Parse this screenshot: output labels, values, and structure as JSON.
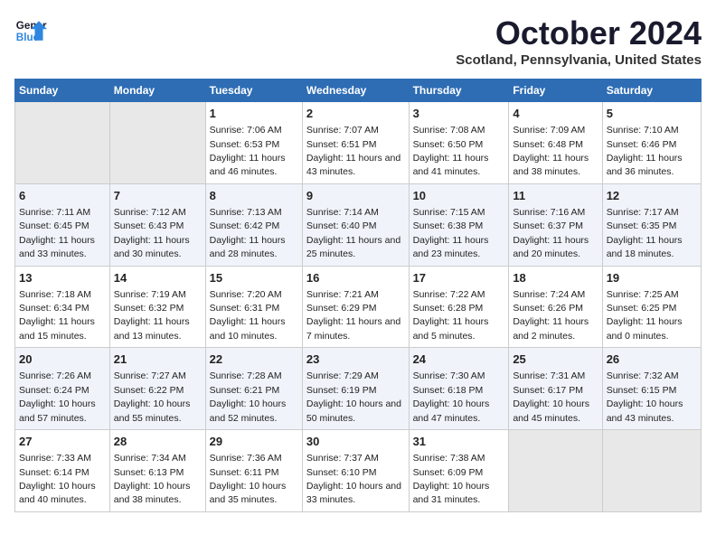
{
  "header": {
    "logo_line1": "General",
    "logo_line2": "Blue",
    "month": "October 2024",
    "location": "Scotland, Pennsylvania, United States"
  },
  "weekdays": [
    "Sunday",
    "Monday",
    "Tuesday",
    "Wednesday",
    "Thursday",
    "Friday",
    "Saturday"
  ],
  "weeks": [
    [
      {
        "day": "",
        "empty": true
      },
      {
        "day": "",
        "empty": true
      },
      {
        "day": "1",
        "sunrise": "Sunrise: 7:06 AM",
        "sunset": "Sunset: 6:53 PM",
        "daylight": "Daylight: 11 hours and 46 minutes."
      },
      {
        "day": "2",
        "sunrise": "Sunrise: 7:07 AM",
        "sunset": "Sunset: 6:51 PM",
        "daylight": "Daylight: 11 hours and 43 minutes."
      },
      {
        "day": "3",
        "sunrise": "Sunrise: 7:08 AM",
        "sunset": "Sunset: 6:50 PM",
        "daylight": "Daylight: 11 hours and 41 minutes."
      },
      {
        "day": "4",
        "sunrise": "Sunrise: 7:09 AM",
        "sunset": "Sunset: 6:48 PM",
        "daylight": "Daylight: 11 hours and 38 minutes."
      },
      {
        "day": "5",
        "sunrise": "Sunrise: 7:10 AM",
        "sunset": "Sunset: 6:46 PM",
        "daylight": "Daylight: 11 hours and 36 minutes."
      }
    ],
    [
      {
        "day": "6",
        "sunrise": "Sunrise: 7:11 AM",
        "sunset": "Sunset: 6:45 PM",
        "daylight": "Daylight: 11 hours and 33 minutes."
      },
      {
        "day": "7",
        "sunrise": "Sunrise: 7:12 AM",
        "sunset": "Sunset: 6:43 PM",
        "daylight": "Daylight: 11 hours and 30 minutes."
      },
      {
        "day": "8",
        "sunrise": "Sunrise: 7:13 AM",
        "sunset": "Sunset: 6:42 PM",
        "daylight": "Daylight: 11 hours and 28 minutes."
      },
      {
        "day": "9",
        "sunrise": "Sunrise: 7:14 AM",
        "sunset": "Sunset: 6:40 PM",
        "daylight": "Daylight: 11 hours and 25 minutes."
      },
      {
        "day": "10",
        "sunrise": "Sunrise: 7:15 AM",
        "sunset": "Sunset: 6:38 PM",
        "daylight": "Daylight: 11 hours and 23 minutes."
      },
      {
        "day": "11",
        "sunrise": "Sunrise: 7:16 AM",
        "sunset": "Sunset: 6:37 PM",
        "daylight": "Daylight: 11 hours and 20 minutes."
      },
      {
        "day": "12",
        "sunrise": "Sunrise: 7:17 AM",
        "sunset": "Sunset: 6:35 PM",
        "daylight": "Daylight: 11 hours and 18 minutes."
      }
    ],
    [
      {
        "day": "13",
        "sunrise": "Sunrise: 7:18 AM",
        "sunset": "Sunset: 6:34 PM",
        "daylight": "Daylight: 11 hours and 15 minutes."
      },
      {
        "day": "14",
        "sunrise": "Sunrise: 7:19 AM",
        "sunset": "Sunset: 6:32 PM",
        "daylight": "Daylight: 11 hours and 13 minutes."
      },
      {
        "day": "15",
        "sunrise": "Sunrise: 7:20 AM",
        "sunset": "Sunset: 6:31 PM",
        "daylight": "Daylight: 11 hours and 10 minutes."
      },
      {
        "day": "16",
        "sunrise": "Sunrise: 7:21 AM",
        "sunset": "Sunset: 6:29 PM",
        "daylight": "Daylight: 11 hours and 7 minutes."
      },
      {
        "day": "17",
        "sunrise": "Sunrise: 7:22 AM",
        "sunset": "Sunset: 6:28 PM",
        "daylight": "Daylight: 11 hours and 5 minutes."
      },
      {
        "day": "18",
        "sunrise": "Sunrise: 7:24 AM",
        "sunset": "Sunset: 6:26 PM",
        "daylight": "Daylight: 11 hours and 2 minutes."
      },
      {
        "day": "19",
        "sunrise": "Sunrise: 7:25 AM",
        "sunset": "Sunset: 6:25 PM",
        "daylight": "Daylight: 11 hours and 0 minutes."
      }
    ],
    [
      {
        "day": "20",
        "sunrise": "Sunrise: 7:26 AM",
        "sunset": "Sunset: 6:24 PM",
        "daylight": "Daylight: 10 hours and 57 minutes."
      },
      {
        "day": "21",
        "sunrise": "Sunrise: 7:27 AM",
        "sunset": "Sunset: 6:22 PM",
        "daylight": "Daylight: 10 hours and 55 minutes."
      },
      {
        "day": "22",
        "sunrise": "Sunrise: 7:28 AM",
        "sunset": "Sunset: 6:21 PM",
        "daylight": "Daylight: 10 hours and 52 minutes."
      },
      {
        "day": "23",
        "sunrise": "Sunrise: 7:29 AM",
        "sunset": "Sunset: 6:19 PM",
        "daylight": "Daylight: 10 hours and 50 minutes."
      },
      {
        "day": "24",
        "sunrise": "Sunrise: 7:30 AM",
        "sunset": "Sunset: 6:18 PM",
        "daylight": "Daylight: 10 hours and 47 minutes."
      },
      {
        "day": "25",
        "sunrise": "Sunrise: 7:31 AM",
        "sunset": "Sunset: 6:17 PM",
        "daylight": "Daylight: 10 hours and 45 minutes."
      },
      {
        "day": "26",
        "sunrise": "Sunrise: 7:32 AM",
        "sunset": "Sunset: 6:15 PM",
        "daylight": "Daylight: 10 hours and 43 minutes."
      }
    ],
    [
      {
        "day": "27",
        "sunrise": "Sunrise: 7:33 AM",
        "sunset": "Sunset: 6:14 PM",
        "daylight": "Daylight: 10 hours and 40 minutes."
      },
      {
        "day": "28",
        "sunrise": "Sunrise: 7:34 AM",
        "sunset": "Sunset: 6:13 PM",
        "daylight": "Daylight: 10 hours and 38 minutes."
      },
      {
        "day": "29",
        "sunrise": "Sunrise: 7:36 AM",
        "sunset": "Sunset: 6:11 PM",
        "daylight": "Daylight: 10 hours and 35 minutes."
      },
      {
        "day": "30",
        "sunrise": "Sunrise: 7:37 AM",
        "sunset": "Sunset: 6:10 PM",
        "daylight": "Daylight: 10 hours and 33 minutes."
      },
      {
        "day": "31",
        "sunrise": "Sunrise: 7:38 AM",
        "sunset": "Sunset: 6:09 PM",
        "daylight": "Daylight: 10 hours and 31 minutes."
      },
      {
        "day": "",
        "empty": true
      },
      {
        "day": "",
        "empty": true
      }
    ]
  ]
}
